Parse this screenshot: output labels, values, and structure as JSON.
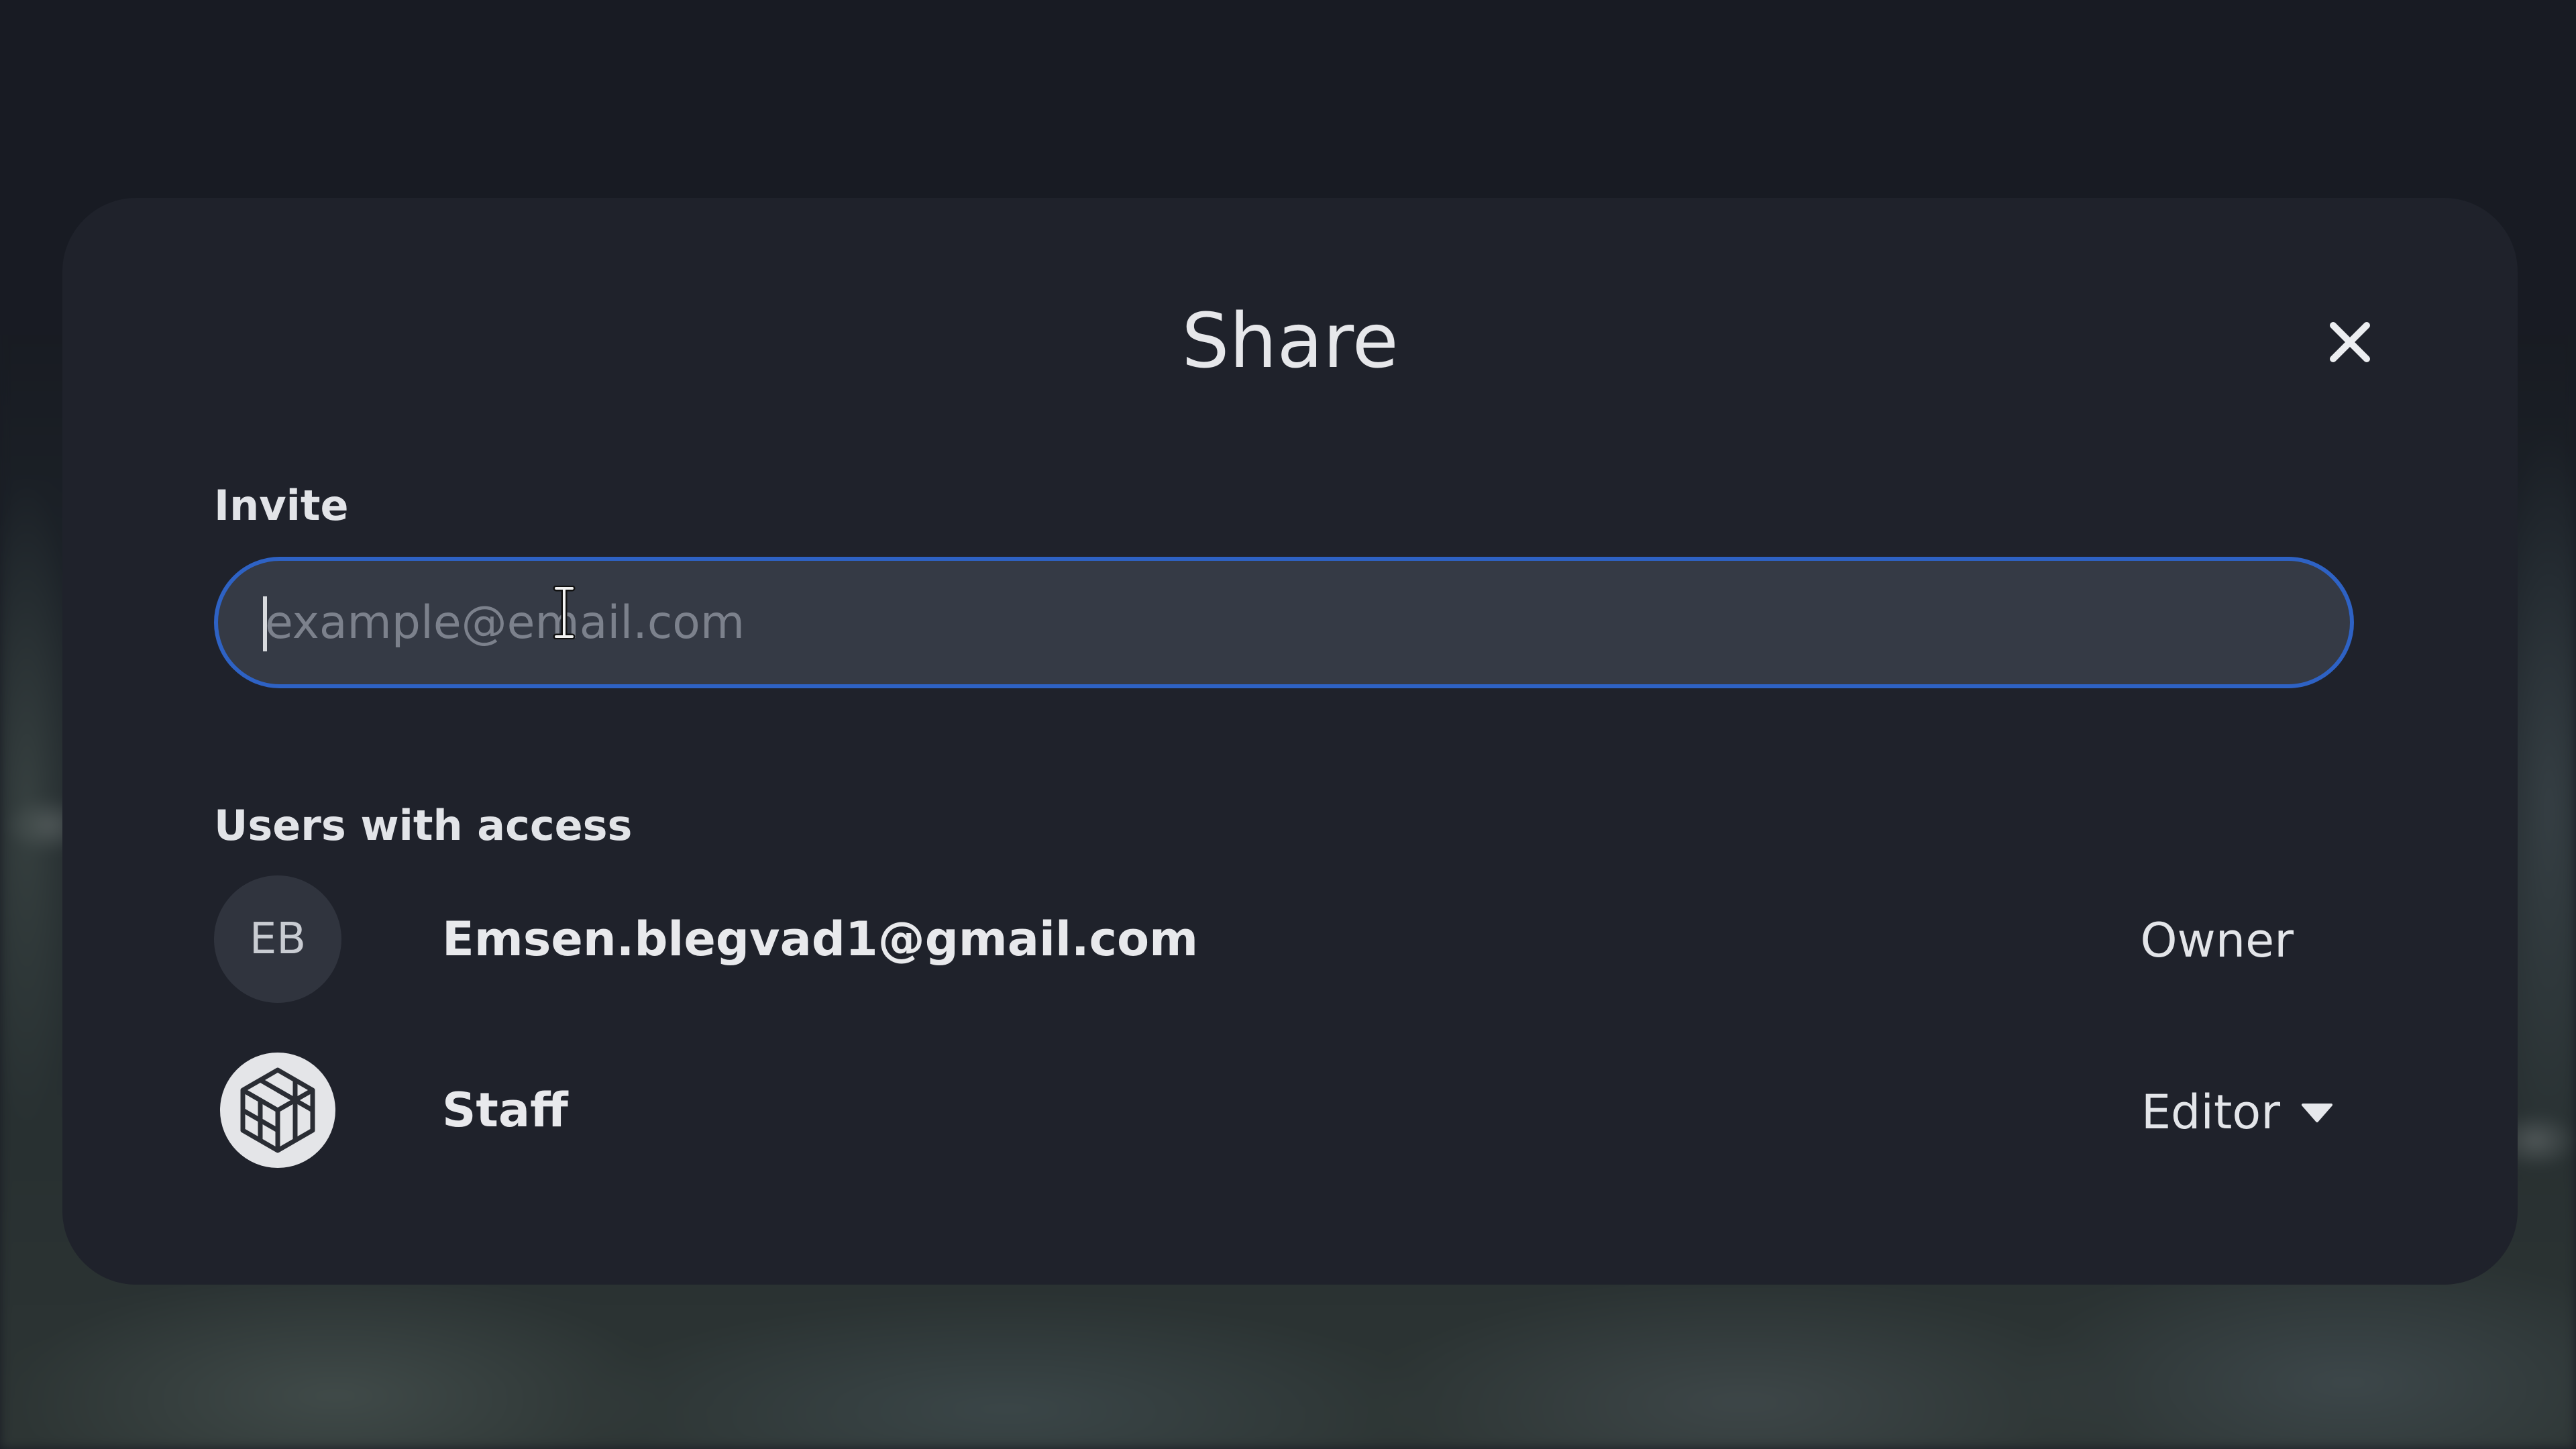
{
  "dialog": {
    "title": "Share",
    "close_icon": "close-icon"
  },
  "invite": {
    "label": "Invite",
    "input_placeholder": "example@email.com",
    "input_value": ""
  },
  "access": {
    "label": "Users with access",
    "users": [
      {
        "avatar_initials": "EB",
        "name": "Emsen.blegvad1@gmail.com",
        "role": "Owner"
      },
      {
        "avatar_icon": "cube-logo-icon",
        "name": "Staff",
        "role": "Editor",
        "role_dropdown_icon": "caret-down-icon"
      }
    ]
  },
  "colors": {
    "modal_background": "#1f222b",
    "input_background": "#353a45",
    "input_focus_border": "#2e62c4",
    "text_primary": "#e8e9ec",
    "placeholder": "#7c818c"
  }
}
